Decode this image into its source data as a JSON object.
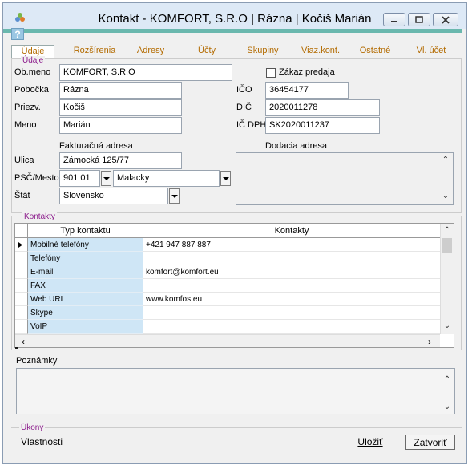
{
  "window": {
    "title": "Kontakt - KOMFORT, S.R.O | Rázna | Kočiš Marián",
    "help_label": "?"
  },
  "tabs": [
    {
      "label": "Údaje",
      "active": true
    },
    {
      "label": "Rozšírenia",
      "active": false
    },
    {
      "label": "Adresy",
      "active": false
    },
    {
      "label": "Účty",
      "active": false
    },
    {
      "label": "Skupiny",
      "active": false
    },
    {
      "label": "Viaz.kont.",
      "active": false
    },
    {
      "label": "Ostatné",
      "active": false
    },
    {
      "label": "Vl. účet",
      "active": false
    }
  ],
  "udaje": {
    "section_label": "Údaje",
    "ob_meno": {
      "label": "Ob.meno",
      "value": "KOMFORT, S.R.O"
    },
    "pobocka": {
      "label": "Pobočka",
      "value": "Rázna"
    },
    "priezv": {
      "label": "Priezv.",
      "value": "Kočiš"
    },
    "meno": {
      "label": "Meno",
      "value": "Marián"
    },
    "zakaz_predaja": {
      "label": "Zákaz predaja",
      "checked": false
    },
    "ico": {
      "label": "IČO",
      "value": "36454177"
    },
    "dic": {
      "label": "DIČ",
      "value": "2020011278"
    },
    "ic_dph": {
      "label": "IČ DPH",
      "value": "SK2020011237"
    }
  },
  "fakturacna": {
    "heading": "Fakturačná adresa",
    "ulica": {
      "label": "Ulica",
      "value": "Zámocká 125/77"
    },
    "psc_mesto": {
      "label": "PSČ/Mesto",
      "psc": "901 01",
      "mesto": "Malacky"
    },
    "stat": {
      "label": "Štát",
      "value": "Slovensko"
    }
  },
  "dodacia": {
    "heading": "Dodacia adresa",
    "value": ""
  },
  "kontakty": {
    "section_label": "Kontakty",
    "columns": [
      "Typ kontaktu",
      "Kontakty"
    ],
    "rows": [
      {
        "type": "Mobilné telefóny",
        "value": "+421 947 887 887",
        "current": true
      },
      {
        "type": "Telefóny",
        "value": ""
      },
      {
        "type": "E-mail",
        "value": "komfort@komfort.eu"
      },
      {
        "type": "FAX",
        "value": ""
      },
      {
        "type": "Web URL",
        "value": "www.komfos.eu"
      },
      {
        "type": "Skype",
        "value": ""
      },
      {
        "type": "VoIP",
        "value": ""
      }
    ]
  },
  "poznamky": {
    "label": "Poznámky",
    "value": ""
  },
  "ukony": {
    "section_label": "Úkony"
  },
  "footer": {
    "vlastnosti": "Vlastnosti",
    "ulozit": "Uložiť",
    "zatvorit": "Zatvoriť"
  },
  "colors": {
    "accent": "#6ab8ae",
    "tab_text": "#b36b00",
    "section_label": "#8b1a8b",
    "grid_type_cell": "#cfe6f6"
  }
}
